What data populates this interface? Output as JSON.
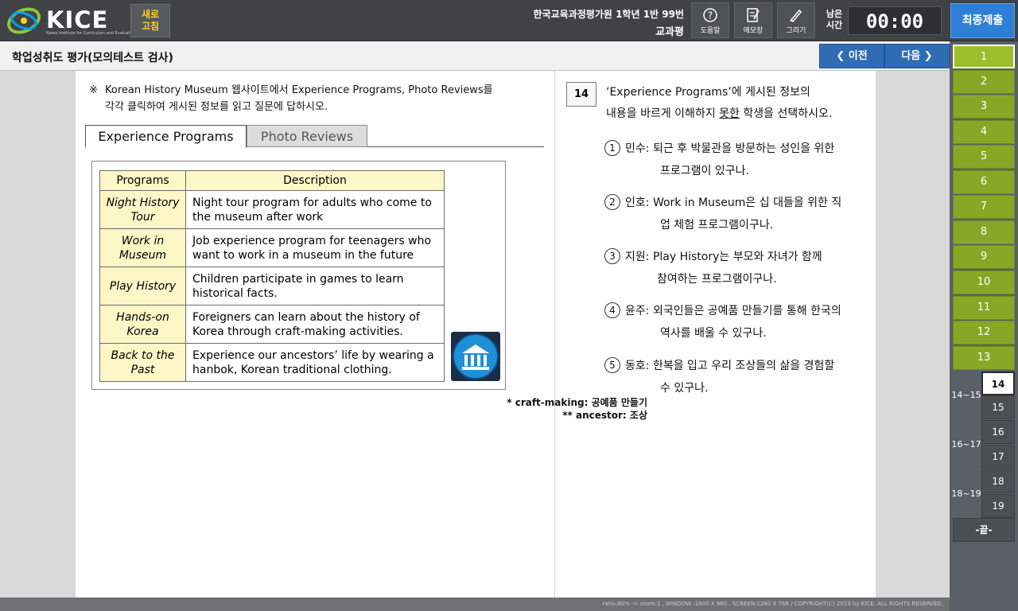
{
  "header": {
    "logo_text": "KICE",
    "logo_sub": "Korea Institute for Curriculum and Evaluation",
    "refresh_label": "새로\n고침",
    "student_line1": "한국교육과정평가원 1학년 1반 99번",
    "student_line2": "교과평",
    "tools": [
      {
        "label": "도움말",
        "icon": "help-icon"
      },
      {
        "label": "메모장",
        "icon": "memo-icon"
      },
      {
        "label": "그리기",
        "icon": "pen-icon"
      }
    ],
    "time_label": "남은\n시간",
    "timer": "00:00",
    "submit_label": "최종제출",
    "accent": "#2e7fd6"
  },
  "titlebar": {
    "title": "학업성취도 평가(모의테스트 검사)",
    "prev_label": "❮ 이전",
    "next_label": "다음 ❯"
  },
  "passage": {
    "instruction_mark": "※",
    "instruction_l1": "Korean History Museum 웹사이트에서 Experience Programs, Photo Reviews를",
    "instruction_l2": "각각 클릭하여 게시된 정보를 읽고 질문에 답하시오.",
    "tabs": [
      "Experience Programs",
      "Photo Reviews"
    ],
    "table_headers": [
      "Programs",
      "Description"
    ],
    "rows": [
      {
        "name": "Night History Tour",
        "desc": "Night tour program for adults who come to the museum after work"
      },
      {
        "name": "Work in Museum",
        "desc": "Job experience program for teenagers who want to work in a museum in the future"
      },
      {
        "name": "Play History",
        "desc": "Children participate in games to learn historical facts."
      },
      {
        "name": "Hands-on Korea",
        "desc": "Foreigners can learn about the history of Korea through craft-making activities."
      },
      {
        "name": "Back to the Past",
        "desc": "Experience our ancestors’ life by wearing a hanbok, Korean traditional clothing."
      }
    ],
    "footnote1": "* craft-making: 공예품 만들기",
    "footnote2": "** ancestor: 조상",
    "icon": "museum-icon"
  },
  "question": {
    "number": "14",
    "stem_part1": "‘Experience Programs’에 게시된 정보의",
    "stem_part2a": "내용을 바르게 이해하지 ",
    "stem_under": "못한",
    "stem_part2b": " 학생을 선택하시오.",
    "choices": [
      {
        "num": "1",
        "who": "민수:",
        "line1": "퇴근 후 박물관을 방문하는 성인을 위한",
        "line2": "프로그램이 있구나."
      },
      {
        "num": "2",
        "who": "인호:",
        "line1": "Work in Museum은 십 대들을 위한 직",
        "line2": "업 체험 프로그램이구나."
      },
      {
        "num": "3",
        "who": "지원:",
        "line1": "Play History는 부모와 자녀가 함께",
        "line2": "참여하는 프로그램이구나."
      },
      {
        "num": "4",
        "who": "윤주:",
        "line1": "외국인들은 공예품 만들기를 통해 한국의",
        "line2": "역사를 배울 수 있구나."
      },
      {
        "num": "5",
        "who": "동호:",
        "line1": "한복을 입고 우리 조상들의 삶을 경험할",
        "line2": "수 있구나."
      }
    ]
  },
  "sidebar": {
    "questions": [
      "1",
      "2",
      "3",
      "4",
      "5",
      "6",
      "7",
      "8",
      "9",
      "10",
      "11",
      "12",
      "13"
    ],
    "groups": [
      {
        "label": "14~15",
        "items": [
          "14",
          "15"
        ]
      },
      {
        "label": "16~17",
        "items": [
          "16",
          "17"
        ]
      },
      {
        "label": "18~19",
        "items": [
          "18",
          "19"
        ]
      }
    ],
    "end_label": "-끝-",
    "current": "14"
  },
  "status_text": "ratio:80% -> zoom:1 , WINDOW :1600 X 960 , SCREEN:1280 X 768 / COPYRIGHT(C) 2019 by KICE. ALL RIGHTS RESERVED."
}
